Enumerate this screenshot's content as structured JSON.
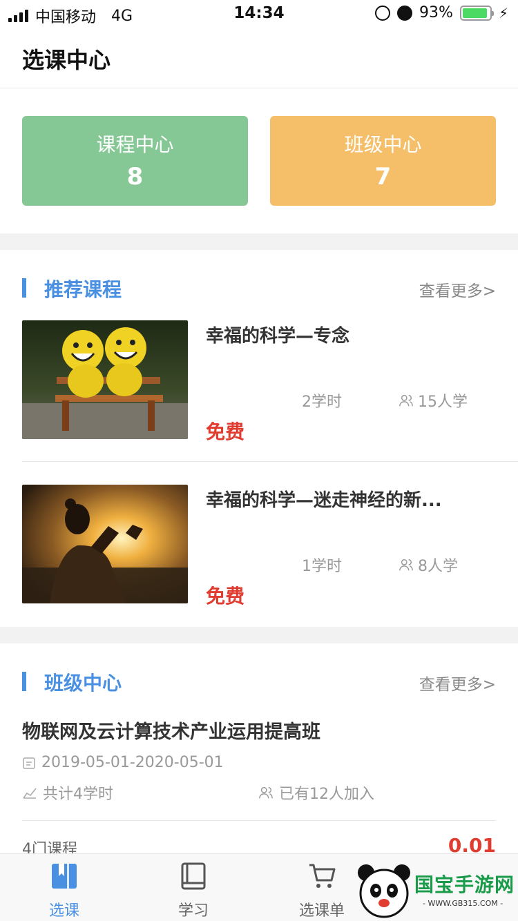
{
  "status_bar": {
    "carrier": "中国移动",
    "network": "4G",
    "time": "14:34",
    "battery": "93%",
    "battery_level": 0.93
  },
  "header": {
    "title": "选课中心"
  },
  "stats": [
    {
      "label": "课程中心",
      "value": "8",
      "color": "#86c895"
    },
    {
      "label": "班级中心",
      "value": "7",
      "color": "#f5bf6a"
    }
  ],
  "recommended": {
    "title": "推荐课程",
    "more": "查看更多>",
    "courses": [
      {
        "title": "幸福的科学—专念",
        "hours": "2学时",
        "students": "15人学",
        "price": "免费"
      },
      {
        "title": "幸福的科学—迷走神经的新...",
        "hours": "1学时",
        "students": "8人学",
        "price": "免费"
      }
    ]
  },
  "class_center": {
    "title": "班级中心",
    "more": "查看更多>",
    "item": {
      "title": "物联网及云计算技术产业运用提高班",
      "dates": "2019-05-01-2020-05-01",
      "hours": "共计4学时",
      "joined": "已有12人加入",
      "course_count": "4门课程",
      "price": "0.01"
    }
  },
  "tabbar": [
    {
      "label": "选课",
      "icon": "bookmark-book-icon",
      "active": true
    },
    {
      "label": "学习",
      "icon": "book-icon",
      "active": false
    },
    {
      "label": "选课单",
      "icon": "cart-icon",
      "active": false
    }
  ],
  "watermark": {
    "text": "国宝手游网",
    "url": "- WWW.GB315.COM -"
  },
  "colors": {
    "accent": "#4a90e2",
    "price": "#e03c30",
    "green_card": "#86c895",
    "orange_card": "#f5bf6a"
  }
}
